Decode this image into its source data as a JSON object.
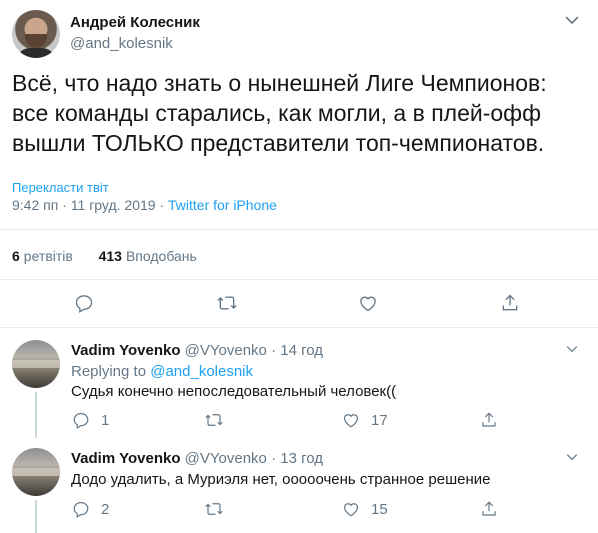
{
  "tweet": {
    "author_name": "Андрей Колесник",
    "author_handle": "@and_kolesnik",
    "text": "Всё, что надо знать о нынешней Лиге Чемпионов: все команды старались, как могли, а в плей-офф вышли ТОЛЬКО представители топ-чемпионатов.",
    "translate_label": "Перекласти твіт",
    "time": "9:42 пп",
    "date": "11 груд. 2019",
    "separator": "·",
    "source": "Twitter for iPhone",
    "retweets_count": "6",
    "retweets_label": "ретвітів",
    "likes_count": "413",
    "likes_label": "Вподобань"
  },
  "replies": [
    {
      "name": "Vadim Yovenko",
      "handle": "@VYovenko",
      "separator": "·",
      "age": "14 год",
      "replying_prefix": "Replying to",
      "replying_to": "@and_kolesnik",
      "text": "Судья конечно непоследовательный человек((",
      "reply_count": "1",
      "retweet_count": "",
      "like_count": "17"
    },
    {
      "name": "Vadim Yovenko",
      "handle": "@VYovenko",
      "separator": "·",
      "age": "13 год",
      "text": "Додо удалить, а Муриэля нет, ооооочень странное решение",
      "reply_count": "2",
      "retweet_count": "",
      "like_count": "15"
    }
  ],
  "icons": {
    "reply": "reply-icon",
    "retweet": "retweet-icon",
    "like": "like-icon",
    "share": "share-icon",
    "more": "chevron-down-icon"
  },
  "colors": {
    "accent": "#1da1f2",
    "muted": "#657786",
    "text": "#14171a",
    "divider": "#e6ecf0"
  }
}
